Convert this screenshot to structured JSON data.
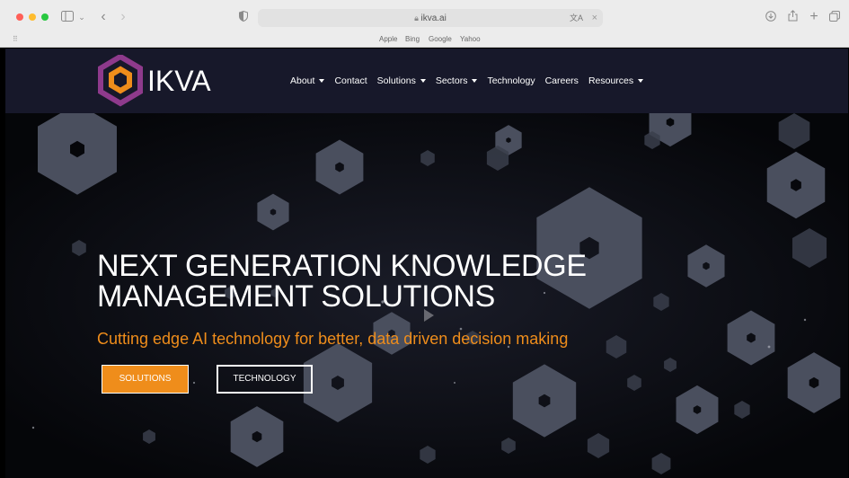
{
  "browser": {
    "url": "ikva.ai",
    "favorites": [
      "Apple",
      "Bing",
      "Google",
      "Yahoo"
    ]
  },
  "site": {
    "logo_text": "IKVA",
    "nav": [
      {
        "label": "About",
        "dropdown": true
      },
      {
        "label": "Contact",
        "dropdown": false
      },
      {
        "label": "Solutions",
        "dropdown": true
      },
      {
        "label": "Sectors",
        "dropdown": true
      },
      {
        "label": "Technology",
        "dropdown": false
      },
      {
        "label": "Careers",
        "dropdown": false
      },
      {
        "label": "Resources",
        "dropdown": true
      }
    ],
    "hero": {
      "headline_line1": "NEXT GENERATION KNOWLEDGE",
      "headline_line2": "MANAGEMENT SOLUTIONS",
      "tagline": "Cutting edge AI technology for better, data driven decision making",
      "primary_button": "SOLUTIONS",
      "secondary_button": "TECHNOLOGY"
    }
  },
  "colors": {
    "accent_orange": "#ef8d1b",
    "navbar_bg": "#17182a",
    "logo_purple": "#8e3a8c"
  }
}
